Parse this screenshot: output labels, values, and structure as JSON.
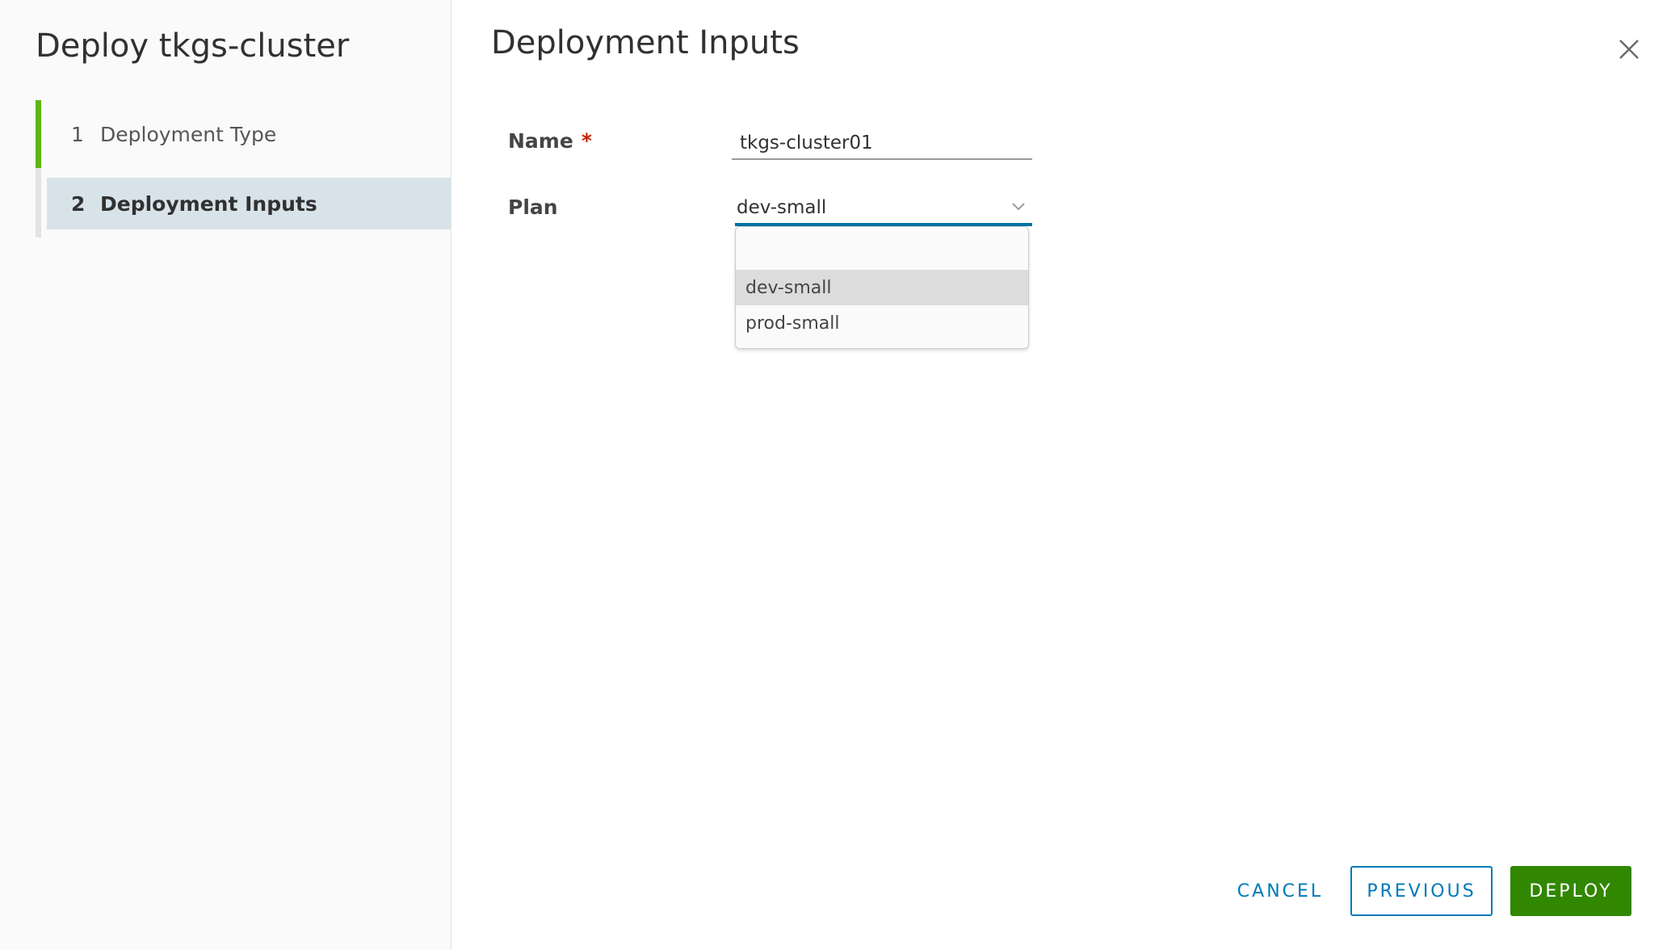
{
  "wizard": {
    "title": "Deploy tkgs-cluster",
    "steps": [
      {
        "number": "1",
        "label": "Deployment Type",
        "state": "completed"
      },
      {
        "number": "2",
        "label": "Deployment Inputs",
        "state": "active"
      }
    ]
  },
  "page": {
    "title": "Deployment Inputs"
  },
  "form": {
    "name": {
      "label": "Name",
      "required_mark": "*",
      "value": "tkgs-cluster01"
    },
    "plan": {
      "label": "Plan",
      "selected": "dev-small",
      "options": [
        "dev-small",
        "prod-small"
      ]
    }
  },
  "footer": {
    "cancel_label": "CANCEL",
    "previous_label": "PREVIOUS",
    "deploy_label": "DEPLOY"
  },
  "colors": {
    "accent": "#0079b8",
    "primary_button": "#318700",
    "completed_step": "#60b515",
    "required": "#c92100"
  },
  "icons": {
    "close": "close-icon",
    "chevron": "chevron-down-icon"
  }
}
